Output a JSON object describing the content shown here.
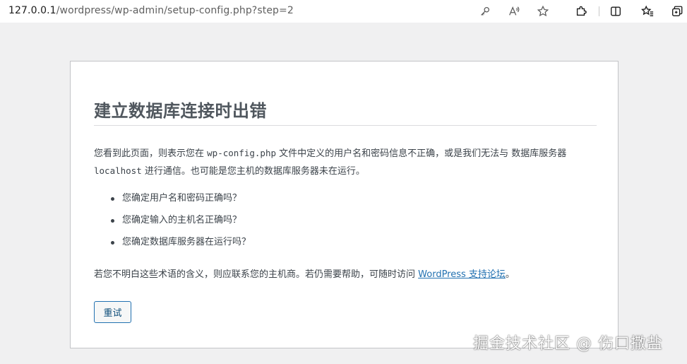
{
  "browser": {
    "url_host": "127.0.0.1",
    "url_path": "/wordpress/wp-admin/setup-config.php?step=2",
    "icons": [
      "key-icon",
      "read-aloud-icon",
      "favorite-star-icon",
      "extensions-icon",
      "split-screen-icon",
      "favorites-icon",
      "collections-icon"
    ]
  },
  "page": {
    "title": "建立数据库连接时出错",
    "intro_part1": "您看到此页面，则表示您在",
    "intro_code1": "wp-config.php",
    "intro_part2": "文件中定义的用户名和密码信息不正确，或是我们无法与 数据库服务器",
    "intro_code2": "localhost",
    "intro_part3": "进行通信。也可能是您主机的数据库服务器未在运行。",
    "checks": [
      "您确定用户名和密码正确吗？",
      "您确定输入的主机名正确吗？",
      "您确定数据库服务器在运行吗？"
    ],
    "help_text": "若您不明白这些术语的含义，则应联系您的主机商。若仍需要帮助，可随时访问",
    "help_link": "WordPress 支持论坛",
    "help_end": "。",
    "retry_label": "重试"
  },
  "watermark": "掘金技术社区 @ 伤口撒盐",
  "colors": {
    "background": "#f0f0f1",
    "card": "#ffffff",
    "link": "#2271b1",
    "title": "#50575e",
    "text": "#3c434a"
  }
}
